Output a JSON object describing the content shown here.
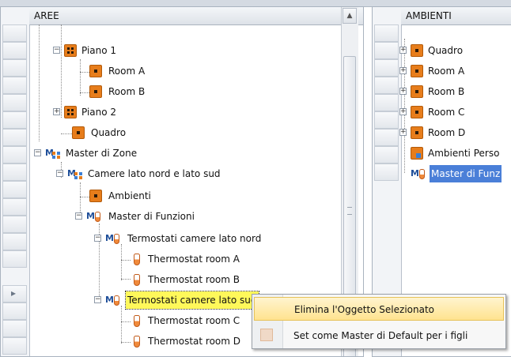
{
  "left_panel": {
    "header": "AREE",
    "tree": [
      {
        "label": "Piano 1"
      },
      {
        "label": "Room A"
      },
      {
        "label": "Room B"
      },
      {
        "label": "Piano 2"
      },
      {
        "label": "Quadro"
      },
      {
        "label": "Master di Zone"
      },
      {
        "label": "Camere lato nord e lato sud"
      },
      {
        "label": "Ambienti"
      },
      {
        "label": "Master di Funzioni"
      },
      {
        "label": "Termostati camere lato nord"
      },
      {
        "label": "Thermostat room A"
      },
      {
        "label": "Thermostat room B"
      },
      {
        "label": "Termostati camere lato sud"
      },
      {
        "label": "Thermostat room C"
      },
      {
        "label": "Thermostat room D"
      }
    ]
  },
  "right_panel": {
    "header": "AMBIENTI",
    "tree": [
      {
        "label": "Quadro"
      },
      {
        "label": "Room A"
      },
      {
        "label": "Room B"
      },
      {
        "label": "Room C"
      },
      {
        "label": "Room D"
      },
      {
        "label": "Ambienti Perso"
      },
      {
        "label": "Master di Funz"
      }
    ]
  },
  "context_menu": {
    "items": [
      {
        "label": "Elimina l'Oggetto Selezionato"
      },
      {
        "label": "Set come Master di Default per i figli"
      }
    ]
  },
  "colors": {
    "selection_yellow": "#fff85a",
    "selection_blue": "#4a7fd8",
    "icon_orange": "#e77d1b"
  }
}
